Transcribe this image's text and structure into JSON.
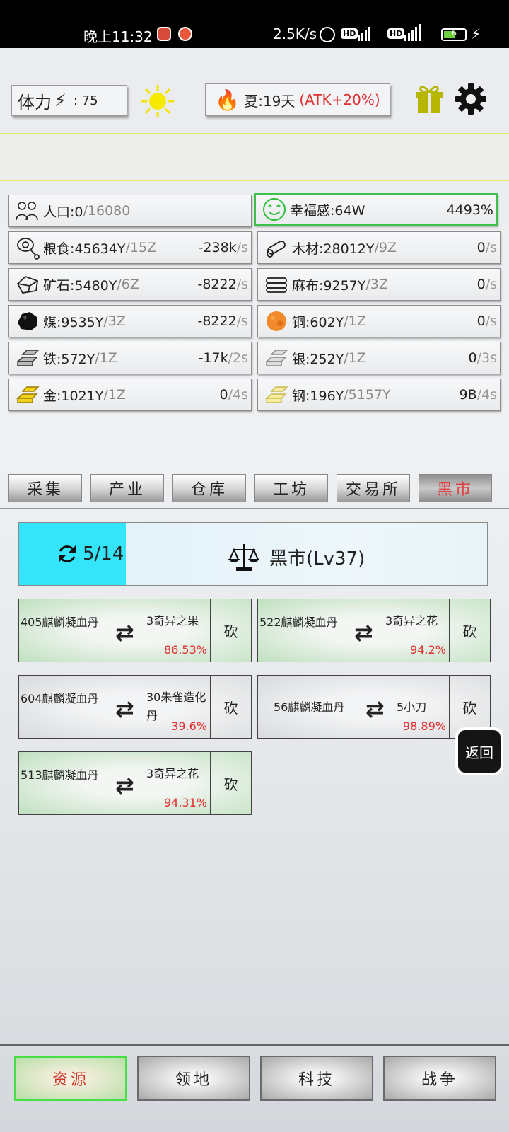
{
  "status_bar": {
    "time": "晚上11:32",
    "net_speed": "2.5K/s",
    "hd1": "HD",
    "hd2": "HD",
    "battery": "6"
  },
  "header": {
    "stamina_label": "体力",
    "stamina_value": ": 75",
    "season_text": "夏:19天",
    "season_bonus": "(ATK+20%)"
  },
  "resources": [
    {
      "name": "人口:0",
      "cap": "/16080",
      "rate": "",
      "per": ""
    },
    {
      "name": "幸福感:64W",
      "cap": "",
      "rate": "4493%",
      "per": ""
    },
    {
      "name": "粮食:45634Y",
      "cap": "/15Z",
      "rate": "-238k",
      "per": "/s"
    },
    {
      "name": "木材:28012Y",
      "cap": "/9Z",
      "rate": "0",
      "per": "/s"
    },
    {
      "name": "矿石:5480Y",
      "cap": "/6Z",
      "rate": "-8222",
      "per": "/s"
    },
    {
      "name": "麻布:9257Y",
      "cap": "/3Z",
      "rate": "0",
      "per": "/s"
    },
    {
      "name": "煤:9535Y",
      "cap": "/3Z",
      "rate": "-8222",
      "per": "/s"
    },
    {
      "name": "铜:602Y",
      "cap": "/1Z",
      "rate": "0",
      "per": "/s"
    },
    {
      "name": "铁:572Y",
      "cap": "/1Z",
      "rate": "-17k",
      "per": "/2s"
    },
    {
      "name": "银:252Y",
      "cap": "/1Z",
      "rate": "0",
      "per": "/3s"
    },
    {
      "name": "金:1021Y",
      "cap": "/1Z",
      "rate": "0",
      "per": "/4s"
    },
    {
      "name": "钢:196Y",
      "cap": "/5157Y",
      "rate": "9B",
      "per": "/4s"
    }
  ],
  "tabs": [
    "采集",
    "产业",
    "仓库",
    "工坊",
    "交易所",
    "黑市"
  ],
  "market": {
    "progress_text": "5/14",
    "progress_fraction": 0.2286,
    "title": "黑市(Lv37)"
  },
  "trades": [
    {
      "give": "405麒麟凝血丹",
      "get": "3奇异之果",
      "pct": "86.53%",
      "btn": "砍"
    },
    {
      "give": "522麒麟凝血丹",
      "get": "3奇异之花",
      "pct": "94.2%",
      "btn": "砍"
    },
    {
      "give": "604麒麟凝血丹",
      "get": "30朱雀造化丹",
      "pct": "39.6%",
      "btn": "砍"
    },
    {
      "give": "56麒麟凝血丹",
      "get": "5小刀",
      "pct": "98.89%",
      "btn": "砍"
    },
    {
      "give": "513麒麟凝血丹",
      "get": "3奇异之花",
      "pct": "94.31%",
      "btn": "砍"
    }
  ],
  "return_label": "返回",
  "bottom_nav": [
    "资源",
    "领地",
    "科技",
    "战争"
  ]
}
